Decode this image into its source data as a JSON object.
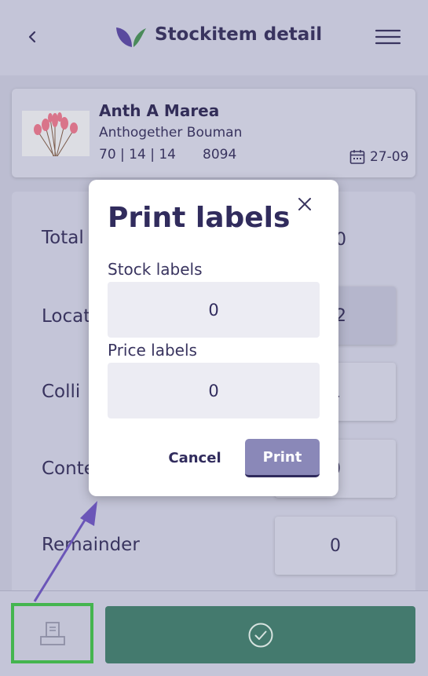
{
  "header": {
    "title": "Stockitem detail",
    "back_icon": "chevron-left-icon",
    "menu_icon": "hamburger-menu-icon",
    "logo": "leaf-logo",
    "colors": {
      "leaf_purple": "#5a4a9e",
      "leaf_green": "#4a8a5a"
    }
  },
  "item": {
    "name": "Anth A Marea",
    "supplier": "Anthogether Bouman",
    "specs": "70 | 14 | 14",
    "code": "8094",
    "date": "27-09",
    "date_icon": "calendar-icon"
  },
  "rows": [
    {
      "label": "Total",
      "value": "20"
    },
    {
      "label": "Location",
      "value": "02"
    },
    {
      "label": "Colli",
      "value": "1"
    },
    {
      "label": "Content",
      "value": "0"
    },
    {
      "label": "Remainder",
      "value": "0"
    }
  ],
  "footer": {
    "print_icon": "printer-icon",
    "confirm_icon": "check-circle-icon",
    "colors": {
      "confirm": "#447a6e",
      "highlight": "#44b54f",
      "arrow": "#6b56b8"
    }
  },
  "modal": {
    "title": "Print labels",
    "close_icon": "close-icon",
    "stock_label": "Stock labels",
    "stock_value": "0",
    "price_label": "Price labels",
    "price_value": "0",
    "cancel": "Cancel",
    "print": "Print"
  }
}
